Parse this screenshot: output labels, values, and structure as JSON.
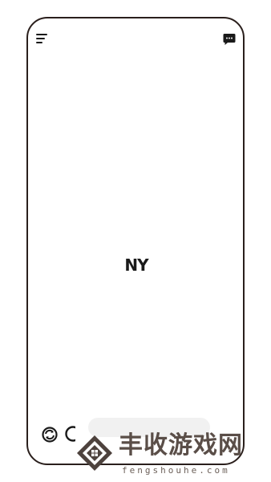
{
  "header": {
    "menu_icon": "hamburger-menu-icon",
    "chat_icon": "chat-bubble-icon"
  },
  "splash": {
    "logo_text": "NY"
  },
  "bottom": {
    "left_icon": "refresh-globe-icon",
    "second_icon": "partial-circle-icon"
  },
  "watermark": {
    "title": "丰收游戏网",
    "domain": "fengshouhe.com",
    "color": "#5a4e48"
  },
  "colors": {
    "frame": "#2a1f1c",
    "background": "#ffffff",
    "pill": "#f1f1f1"
  }
}
